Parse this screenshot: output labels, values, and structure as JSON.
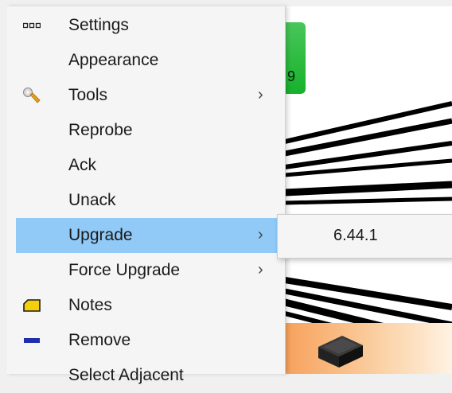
{
  "background": {
    "node_label": "9"
  },
  "menu": {
    "items": [
      {
        "label": "Settings",
        "icon": "settings-dots-icon",
        "has_submenu": false
      },
      {
        "label": "Appearance",
        "icon": "",
        "has_submenu": false
      },
      {
        "label": "Tools",
        "icon": "wrench-icon",
        "has_submenu": true
      },
      {
        "label": "Reprobe",
        "icon": "",
        "has_submenu": false
      },
      {
        "label": "Ack",
        "icon": "",
        "has_submenu": false
      },
      {
        "label": "Unack",
        "icon": "",
        "has_submenu": false
      },
      {
        "label": "Upgrade",
        "icon": "",
        "has_submenu": true,
        "highlighted": true
      },
      {
        "label": "Force Upgrade",
        "icon": "",
        "has_submenu": true
      },
      {
        "label": "Notes",
        "icon": "note-icon",
        "has_submenu": false
      },
      {
        "label": "Remove",
        "icon": "remove-minus-icon",
        "has_submenu": false
      },
      {
        "label": "Select Adjacent",
        "icon": "",
        "has_submenu": false
      }
    ],
    "submenu_arrow": "›"
  },
  "upgrade_submenu": {
    "items": [
      {
        "label": "6.44.1"
      }
    ]
  },
  "colors": {
    "highlight": "#91c9f7",
    "node_green": "#16b22b",
    "notes_yellow": "#f4d00c",
    "remove_blue": "#1e2fa8"
  }
}
